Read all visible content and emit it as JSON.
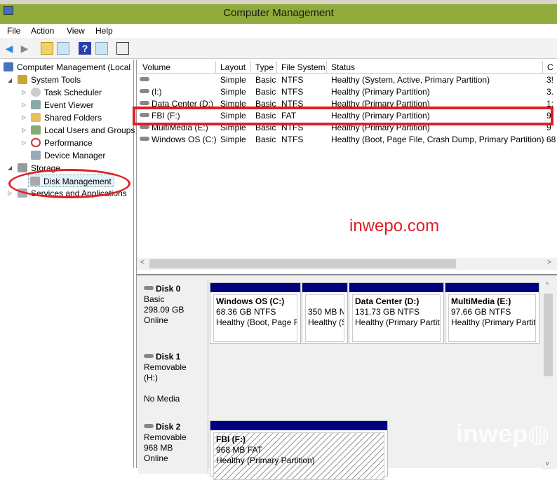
{
  "window": {
    "title": "Computer Management"
  },
  "menu": [
    "File",
    "Action",
    "View",
    "Help"
  ],
  "tree": {
    "root": "Computer Management (Local",
    "system_tools": "System Tools",
    "items": [
      "Task Scheduler",
      "Event Viewer",
      "Shared Folders",
      "Local Users and Groups",
      "Performance",
      "Device Manager"
    ],
    "storage": "Storage",
    "disk_management": "Disk Management",
    "services": "Services and Applications"
  },
  "columns": [
    "Volume",
    "Layout",
    "Type",
    "File System",
    "Status",
    "C"
  ],
  "volumes": [
    {
      "name": "",
      "layout": "Simple",
      "type": "Basic",
      "fs": "NTFS",
      "status": "Healthy (System, Active, Primary Partition)",
      "cap": "3!"
    },
    {
      "name": "(I:)",
      "layout": "Simple",
      "type": "Basic",
      "fs": "NTFS",
      "status": "Healthy (Primary Partition)",
      "cap": "3."
    },
    {
      "name": "Data Center (D:)",
      "layout": "Simple",
      "type": "Basic",
      "fs": "NTFS",
      "status": "Healthy (Primary Partition)",
      "cap": "1:"
    },
    {
      "name": "FBI (F:)",
      "layout": "Simple",
      "type": "Basic",
      "fs": "FAT",
      "status": "Healthy (Primary Partition)",
      "cap": "9"
    },
    {
      "name": "MultiMedia (E:)",
      "layout": "Simple",
      "type": "Basic",
      "fs": "NTFS",
      "status": "Healthy (Primary Partition)",
      "cap": "9"
    },
    {
      "name": "Windows OS (C:)",
      "layout": "Simple",
      "type": "Basic",
      "fs": "NTFS",
      "status": "Healthy (Boot, Page File, Crash Dump, Primary Partition)",
      "cap": "68"
    }
  ],
  "watermark_text": "inwepo.com",
  "watermark_logo": "inwepo",
  "disks": [
    {
      "name": "Disk 0",
      "l1": "Basic",
      "l2": "298.09 GB",
      "l3": "Online",
      "parts": [
        {
          "title": "Windows OS  (C:)",
          "size": "68.36 GB NTFS",
          "status": "Healthy (Boot, Page F"
        },
        {
          "title": "",
          "size": "350 MB N",
          "status": "Healthy (S"
        },
        {
          "title": "Data Center  (D:)",
          "size": "131.73 GB NTFS",
          "status": "Healthy (Primary Partit"
        },
        {
          "title": "MultiMedia  (E:)",
          "size": "97.66 GB NTFS",
          "status": "Healthy (Primary Partit"
        }
      ]
    },
    {
      "name": "Disk 1",
      "l1": "Removable (H:)",
      "l2": "",
      "l3": "No Media"
    },
    {
      "name": "Disk 2",
      "l1": "Removable",
      "l2": "968 MB",
      "l3": "Online",
      "parts": [
        {
          "title": "FBI  (F:)",
          "size": "968 MB FAT",
          "status": "Healthy (Primary Partition)"
        }
      ]
    }
  ]
}
